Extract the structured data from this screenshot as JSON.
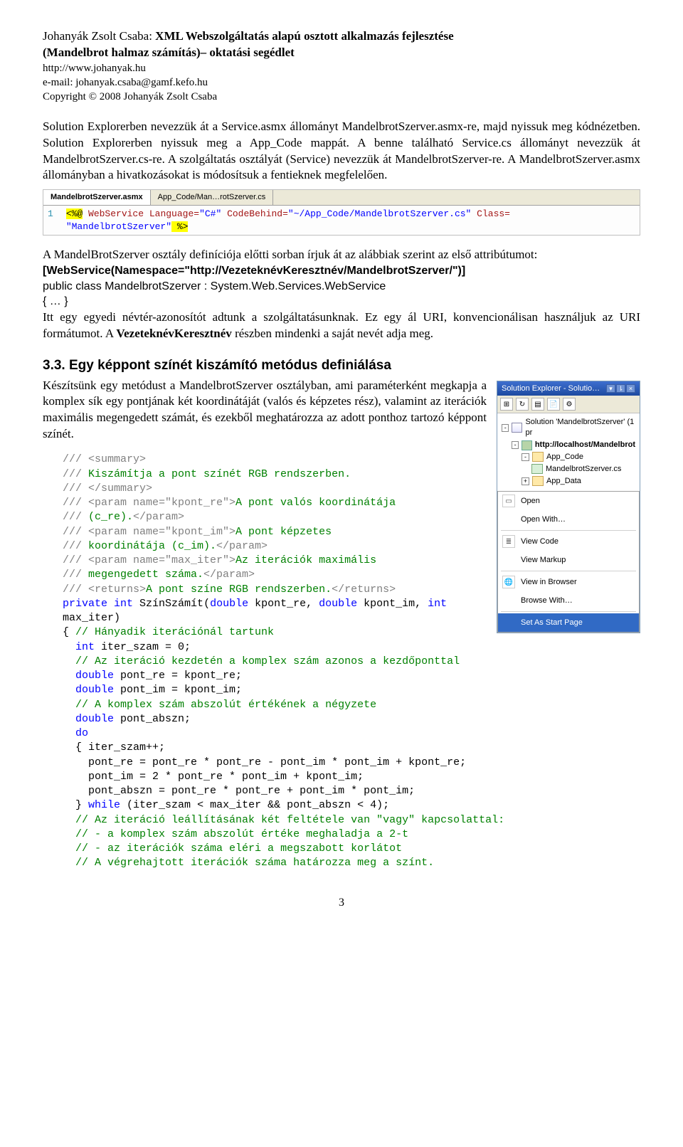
{
  "header": {
    "author": "Johanyák Zsolt Csaba: ",
    "title_bold": "XML Webszolgáltatás alapú osztott alkalmazás fejlesztése",
    "title_line2": "(Mandelbrot halmaz számítás)– oktatási segédlet",
    "url": "http://www.johanyak.hu",
    "email": "e-mail: johanyak.csaba@gamf.kefo.hu",
    "copyright": "Copyright © 2008 Johanyák Zsolt Csaba"
  },
  "para1": "Solution Explorerben nevezzük át a Service.asmx állományt MandelbrotSzerver.asmx-re, majd nyissuk meg kódnézetben. Solution Explorerben nyissuk meg a App_Code mappát. A benne található Service.cs állományt nevezzük át MandelbrotSzerver.cs-re. A szolgáltatás osztályát (Service) nevezzük át MandelbrotSzerver-re. A MandelbrotSzerver.asmx állományban a hivatkozásokat is módosítsuk a fentieknek megfelelően.",
  "codess": {
    "tab1": "MandelbrotSzerver.asmx",
    "tab2": "App_Code/Man…rotSzerver.cs",
    "gutter": "1",
    "tok_open": "<%@",
    "tok_ws": " WebService ",
    "attr_lang": "Language=",
    "val_lang": "\"C#\"",
    "attr_cb": " CodeBehind=",
    "val_cb": "\"~/App_Code/MandelbrotSzerver.cs\"",
    "attr_cls": " Class=",
    "val_cls_line2": "\"MandelbrotSzerver\"",
    "tok_close": " %>"
  },
  "after_ss": {
    "p1": "A MandelBrotSzerver osztály definíciója előtti sorban írjuk át az alábbiak szerint az első attribútumot:",
    "attr_line": "[WebService(Namespace=\"http://VezeteknévKeresztnév/MandelbrotSzerver/\")]",
    "cls_prefix": "public class ",
    "cls_name": "MandelbrotSzerver",
    "cls_suffix": " : System.Web.Services.WebService",
    "braces": "{ … }",
    "p2a": "Itt egy egyedi névtér-azonosítót adtunk a szolgáltatásunknak. Ez egy ál URI, konvencionálisan használjuk az URI formátumot. A ",
    "p2b": "VezeteknévKeresztnév",
    "p2c": " részben mindenki a saját nevét adja meg."
  },
  "section": {
    "heading": "3.3. Egy képpont színét kiszámító metódus definiálása",
    "p": "Készítsünk egy metódust a MandelbrotSzerver osztályban, ami paraméterként megkapja a komplex sík egy pontjának két koordinátáját (valós és képzetes rész), valamint az iterációk maximális megengedett számát, és ezekből meghatározza az adott ponthoz tartozó képpont színét."
  },
  "se": {
    "title": "Solution Explorer - Solutio…",
    "nodes": {
      "sol": "Solution 'MandelbrotSzerver' (1 pr",
      "prj": "http://localhost/Mandelbrot",
      "appcode": "App_Code",
      "csfile": "MandelbrotSzerver.cs",
      "appdata": "App_Data"
    },
    "menu": {
      "open": "Open",
      "openwith": "Open With…",
      "viewcode": "View Code",
      "viewmarkup": "View Markup",
      "viewbrowser": "View in Browser",
      "browsewith": "Browse With…",
      "setstart": "Set As Start Page"
    }
  },
  "code": {
    "l1": "/// <summary>",
    "l2a": "/// ",
    "l2b": "Kiszámítja a pont színét RGB rendszerben.",
    "l3": "/// </summary>",
    "l4a": "/// <param name=\"kpont_re\">",
    "l4b": "A pont valós koordinátája",
    "l5a": "/// ",
    "l5b": "(c_re).",
    "l5c": "</param>",
    "l6a": "/// <param name=\"kpont_im\">",
    "l6b": "A pont képzetes",
    "l7a": "/// ",
    "l7b": "koordinátája (c_im).",
    "l7c": "</param>",
    "l8a": "/// <param name=\"max_iter\">",
    "l8b": "Az iterációk maximális",
    "l9a": "/// ",
    "l9b": "megengedett száma.",
    "l9c": "</param>",
    "l10a": "/// <returns>",
    "l10b": "A pont színe RGB rendszerben.",
    "l10c": "</returns>",
    "l11a": "private",
    "l11s1": " ",
    "l11b": "int",
    "l11s2": " SzínSzámít(",
    "l11c": "double",
    "l11s3": " kpont_re, ",
    "l11d": "double",
    "l11s4": " kpont_im, ",
    "l11e": "int",
    "l11s5": " max_iter)",
    "l12": "{ ",
    "l12c": "// Hányadik iterációnál tartunk",
    "l13a": "  ",
    "l13b": "int",
    "l13c": " iter_szam = 0;",
    "l14": "  // Az iteráció kezdetén a komplex szám azonos a kezdőponttal",
    "l15a": "  ",
    "l15b": "double",
    "l15c": " pont_re = kpont_re;",
    "l16a": "  ",
    "l16b": "double",
    "l16c": " pont_im = kpont_im;",
    "l17": "  // A komplex szám abszolút értékének a négyzete",
    "l18a": "  ",
    "l18b": "double",
    "l18c": " pont_abszn;",
    "l19a": "  ",
    "l19b": "do",
    "l20": "  { iter_szam++;",
    "l21": "    pont_re = pont_re * pont_re - pont_im * pont_im + kpont_re;",
    "l22": "    pont_im = 2 * pont_re * pont_im + kpont_im;",
    "l23": "    pont_abszn = pont_re * pont_re + pont_im * pont_im;",
    "l24a": "  } ",
    "l24b": "while",
    "l24c": " (iter_szam < max_iter && pont_abszn < 4);",
    "l25": "  // Az iteráció leállításának két feltétele van \"vagy\" kapcsolattal:",
    "l26": "  // - a komplex szám abszolút értéke meghaladja a 2-t",
    "l27": "  // - az iterációk száma eléri a megszabott korlátot",
    "l28": "  // A végrehajtott iterációk száma határozza meg a színt."
  },
  "pagenum": "3"
}
